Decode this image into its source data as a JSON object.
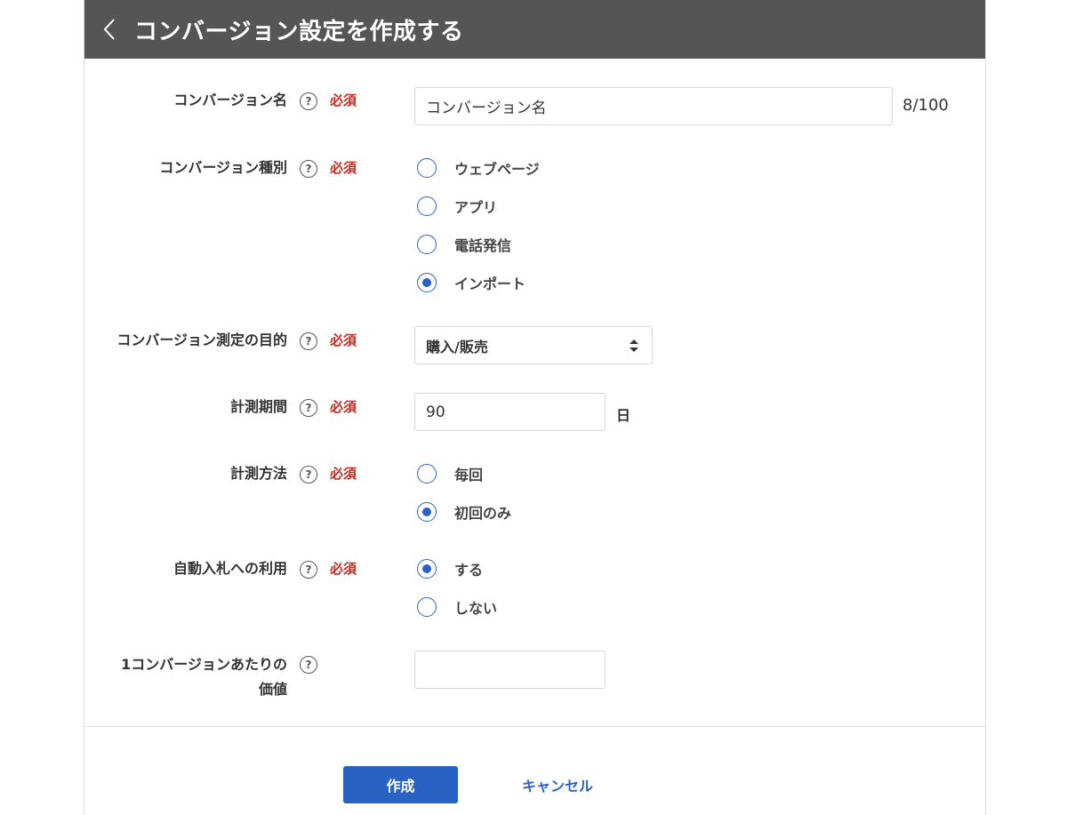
{
  "header": {
    "title": "コンバージョン設定を作成する",
    "back_icon": "chevron-left-icon"
  },
  "help_glyph": "?",
  "required_label": "必須",
  "fields": {
    "name": {
      "label": "コンバージョン名",
      "value": "コンバージョン名",
      "counter": "8/100"
    },
    "type": {
      "label": "コンバージョン種別",
      "options": [
        "ウェブページ",
        "アプリ",
        "電話発信",
        "インポート"
      ],
      "selected": "インポート"
    },
    "purpose": {
      "label": "コンバージョン測定の目的",
      "value": "購入/販売"
    },
    "period": {
      "label": "計測期間",
      "value": "90",
      "unit": "日"
    },
    "method": {
      "label": "計測方法",
      "options": [
        "毎回",
        "初回のみ"
      ],
      "selected": "初回のみ"
    },
    "auto_bid": {
      "label": "自動入札への利用",
      "options": [
        "する",
        "しない"
      ],
      "selected": "する"
    },
    "value_per_conversion": {
      "label_line1": "1コンバージョンあたりの",
      "label_line2": "価値",
      "value": ""
    }
  },
  "footer": {
    "create_label": "作成",
    "cancel_label": "キャンセル"
  },
  "colors": {
    "header_bg": "#555555",
    "accent": "#2a62c4",
    "required": "#c8281e"
  }
}
